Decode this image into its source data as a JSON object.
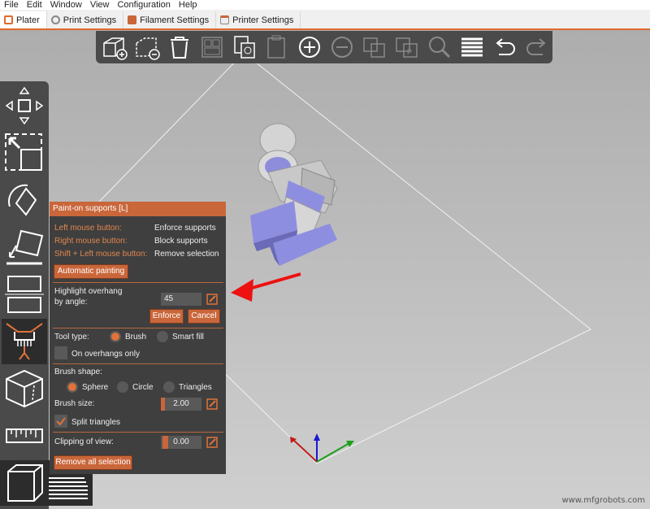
{
  "menu": [
    "File",
    "Edit",
    "Window",
    "View",
    "Configuration",
    "Help"
  ],
  "tabs": [
    {
      "label": "Plater",
      "icon": "plater-icon"
    },
    {
      "label": "Print Settings",
      "icon": "print-settings-icon"
    },
    {
      "label": "Filament Settings",
      "icon": "filament-settings-icon"
    },
    {
      "label": "Printer Settings",
      "icon": "printer-settings-icon"
    }
  ],
  "toolbar": {
    "tools": [
      "add",
      "delete",
      "delete-all",
      "arrange",
      "copy",
      "paste",
      "add-instance",
      "remove-instance",
      "split-objects",
      "split-parts",
      "search",
      "layers",
      "undo",
      "redo"
    ]
  },
  "left_tools": [
    "move",
    "scale",
    "rotate",
    "place-on-face",
    "cut",
    "paint-supports",
    "seam-painting",
    "measure",
    "view-mode"
  ],
  "panel": {
    "title": "Paint-on supports [L]",
    "left_mouse_label": "Left mouse button:",
    "left_mouse_action": "Enforce supports",
    "right_mouse_label": "Right mouse button:",
    "right_mouse_action": "Block supports",
    "shift_left_label": "Shift + Left mouse button:",
    "shift_left_action": "Remove selection",
    "auto_painting": "Automatic painting",
    "highlight_label_1": "Highlight overhang",
    "highlight_label_2": "by angle:",
    "highlight_value": "45",
    "enforce": "Enforce",
    "cancel": "Cancel",
    "tool_type_label": "Tool type:",
    "tool_brush": "Brush",
    "tool_smart_fill": "Smart fill",
    "on_overhangs_only": "On overhangs only",
    "brush_shape_label": "Brush shape:",
    "shape_sphere": "Sphere",
    "shape_circle": "Circle",
    "shape_triangles": "Triangles",
    "brush_size_label": "Brush size:",
    "brush_size_value": "2.00",
    "brush_size_fraction": 0.1,
    "split_triangles": "Split triangles",
    "clipping_label": "Clipping of view:",
    "clipping_value": "0.00",
    "remove_all": "Remove all selection"
  },
  "watermark": "www.mfgrobots.com",
  "colors": {
    "accent": "#c9663a",
    "panel_bg": "#3f3f3f",
    "toolbar_bg": "#4a4a4a",
    "support_blue": "#8f8fe0"
  }
}
